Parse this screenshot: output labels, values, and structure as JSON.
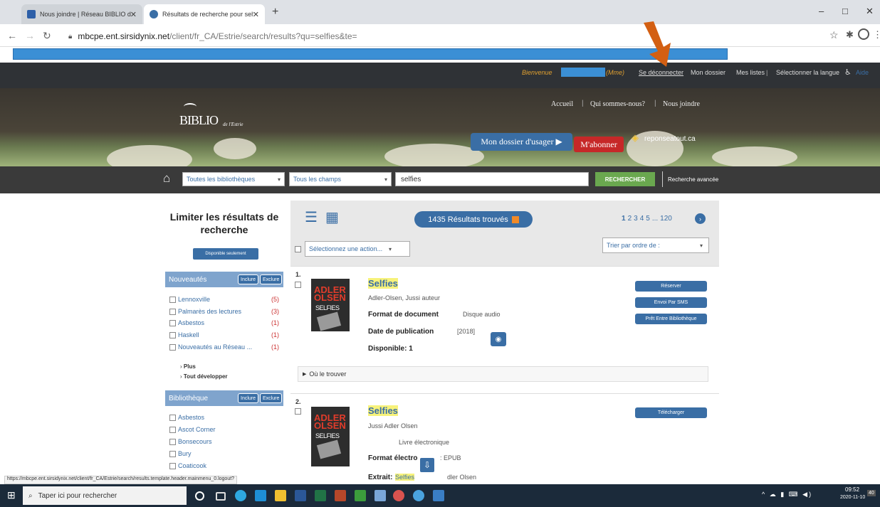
{
  "browser": {
    "tabs": [
      {
        "label": "Nous joindre | Réseau BIBLIO de l'Estrie",
        "close": "✕"
      },
      {
        "label": "Résultats de recherche pour selfies",
        "close": "✕"
      }
    ],
    "new_tab": "+",
    "url_domain": "mbcpe.ent.sirsidynix.net",
    "url_path": "/client/fr_CA/Estrie/search/results?qu=selfies&te=",
    "window_controls": [
      "–",
      "□",
      "✕"
    ]
  },
  "topbar": {
    "welcome": "Bienvenue",
    "title": "(Mme)",
    "logout": "Se déconnecter",
    "my_account": "Mon dossier",
    "my_lists": "Mes listes",
    "language": "Sélectionner la langue",
    "help": "Aide"
  },
  "header": {
    "logo_main": "BIBLIO",
    "logo_sub": "de l'Estrie",
    "links": [
      "Accueil",
      "Qui sommes-nous?",
      "Nous joindre"
    ],
    "account_btn": "Mon dossier d'usager ▶",
    "subscribe_btn": "M'abonner",
    "partner": "reponseatout.ca"
  },
  "search": {
    "library_select": "Toutes les bibliothèques",
    "field_select": "Tous les champs",
    "query": "selfies",
    "search_btn": "RECHERCHER",
    "advanced": "Recherche avancée"
  },
  "sidebar": {
    "title": "Limiter les résultats de recherche",
    "available_btn": "Disponible seulement",
    "nouveautes": {
      "heading": "Nouveautés",
      "include": "Inclure",
      "exclude": "Exclure",
      "items": [
        {
          "label": "Lennoxville",
          "count": "(5)"
        },
        {
          "label": "Palmarès des lectures",
          "count": "(3)"
        },
        {
          "label": "Asbestos",
          "count": "(1)"
        },
        {
          "label": "Haskell",
          "count": "(1)"
        },
        {
          "label": "Nouveautés au Réseau ...",
          "count": "(1)"
        }
      ],
      "more": "Plus",
      "expand": "Tout développer"
    },
    "bibliotheque": {
      "heading": "Bibliothèque",
      "include": "Inclure",
      "exclude": "Exclure",
      "items": [
        "Asbestos",
        "Ascot Corner",
        "Bonsecours",
        "Bury",
        "Coaticook"
      ]
    }
  },
  "results": {
    "count_badge": "1435 Résultats trouvés",
    "pages": [
      "1",
      "2",
      "3",
      "4",
      "5",
      "...",
      "120"
    ],
    "action_select": "Sélectionnez une action...",
    "sort_select": "Trier par ordre de :",
    "items": [
      {
        "num": "1.",
        "title": "Selfies",
        "author": "Adler-Olsen, Jussi auteur",
        "format_label": "Format de document",
        "format_value": "Disque audio",
        "date_label": "Date de publication",
        "date_value": "[2018]",
        "availability": "Disponible: 1",
        "where": "Où le trouver",
        "buttons": [
          "Réserver",
          "Envoi Par SMS",
          "Prêt Entre Bibliothèque"
        ]
      },
      {
        "num": "2.",
        "title": "Selfies",
        "author": "Jussi Adler Olsen",
        "type": "Livre électronique",
        "format_label": "Format électro",
        "format_value": ": EPUB",
        "extract_label": "Extrait:",
        "extract_value": "Selfies",
        "extract_tail": "dler Olsen",
        "buttons": [
          "Télécharger"
        ]
      }
    ]
  },
  "statusbar": {
    "url": "https://mbcpe.ent.sirsidynix.net/client/fr_CA/Estrie/search/results.template.header.mainmenu_0.logout?"
  },
  "taskbar": {
    "search_placeholder": "Taper ici pour rechercher",
    "time": "09:52",
    "date": "2020-11-10",
    "notif_count": "40"
  },
  "colors": {
    "accent_blue": "#3a6ea5",
    "highlight": "#f7f27a",
    "arrow_orange": "#d35f12"
  }
}
